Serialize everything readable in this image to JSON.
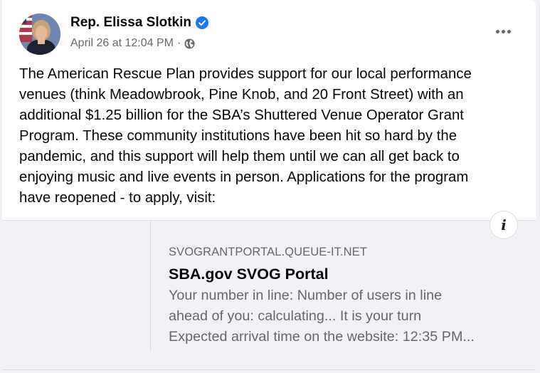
{
  "post": {
    "author": "Rep. Elissa Slotkin",
    "verified": true,
    "timestamp": "April 26 at 12:04 PM",
    "separator": "·",
    "audience_icon": "globe-icon",
    "more_icon": "more-options-icon",
    "text": "The American Rescue Plan provides support for our local performance\nvenues (think Meadowbrook, Pine Knob, and 20 Front Street) with an\nadditional $1.25 billion for the SBA’s Shuttered Venue Operator Grant\nProgram. These community institutions have been hit so hard by the\npandemic, and this support will help them until we can all get back to\nenjoying music and live events in person. Applications for the program\nhave reopened - to apply, visit:"
  },
  "link_preview": {
    "domain": "SVOGRANTPORTAL.QUEUE-IT.NET",
    "title": "SBA.gov SVOG Portal",
    "description": "Your number in line: Number of users in line\nahead of you: calculating... It is your turn\nExpected arrival time on the website: 12:35 PM...",
    "info_icon": "info-icon",
    "info_glyph": "i"
  },
  "colors": {
    "verified_blue": "#1877f2",
    "secondary_text": "#65676b",
    "primary_text": "#050505",
    "preview_bg": "#f0f2f5"
  }
}
